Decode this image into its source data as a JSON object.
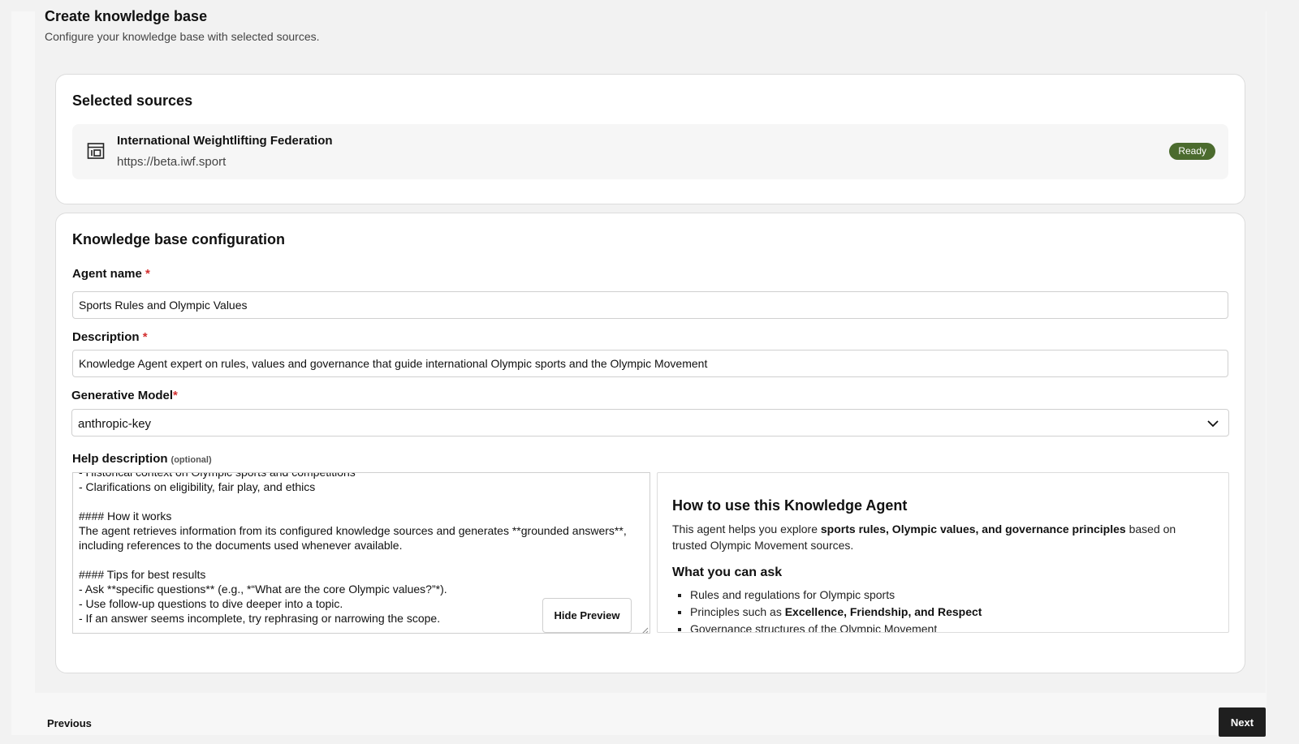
{
  "header": {
    "title": "Create knowledge base",
    "subtitle": "Configure your knowledge base with selected sources."
  },
  "sources": {
    "title": "Selected sources",
    "items": [
      {
        "name": "International Weightlifting Federation",
        "url": "https://beta.iwf.sport",
        "status": "Ready",
        "icon": "web-page-icon"
      }
    ]
  },
  "config": {
    "title": "Knowledge base configuration",
    "agent_name": {
      "label": "Agent name",
      "required_mark": "*",
      "value": "Sports Rules and Olympic Values"
    },
    "description": {
      "label": "Description",
      "required_mark": "*",
      "value": "Knowledge Agent expert on rules, values and governance that guide international Olympic sports and the Olympic Movement"
    },
    "model": {
      "label": "Generative Model",
      "required_mark": "*",
      "value": "anthropic-key"
    },
    "help": {
      "label": "Help description",
      "optional": "(optional)",
      "editor_text": "- Historical context on Olympic sports and competitions\n- Clarifications on eligibility, fair play, and ethics\n\n#### How it works\nThe agent retrieves information from its configured knowledge sources and generates **grounded answers**, including references to the documents used whenever available.\n\n#### Tips for best results\n- Ask **specific questions** (e.g., *“What are the core Olympic values?”*).\n- Use follow-up questions to dive deeper into a topic.\n- If an answer seems incomplete, try rephrasing or narrowing the scope.",
      "hide_preview_label": "Hide Preview",
      "preview": {
        "heading": "How to use this Knowledge Agent",
        "intro_prefix": "This agent helps you explore ",
        "intro_bold": "sports rules, Olympic values, and governance principles",
        "intro_suffix": " based on trusted Olympic Movement sources.",
        "subheading": "What you can ask",
        "item1": "Rules and regulations for Olympic sports",
        "item2_prefix": "Principles such as ",
        "item2_bold": "Excellence, Friendship, and Respect",
        "item3": "Governance structures of the Olympic Movement"
      }
    }
  },
  "footer": {
    "previous_label": "Previous",
    "next_label": "Next"
  },
  "colors": {
    "ready_badge": "#4b6b2e",
    "required": "#d32f2f",
    "next_button": "#1f1f1f"
  }
}
